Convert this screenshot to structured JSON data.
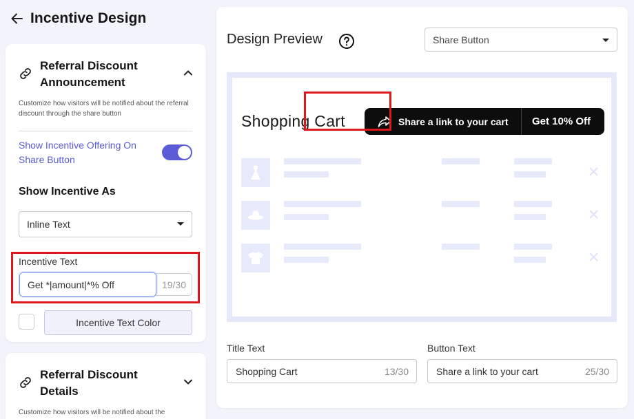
{
  "header": {
    "title": "Incentive Design"
  },
  "sections": [
    {
      "title": "Referral Discount Announcement",
      "description": "Customize how visitors will be notified about the referral discount through the share button",
      "toggle_label": "Show Incentive Offering On Share Button",
      "toggle_on": true,
      "show_as_label": "Show Incentive As",
      "show_as_value": "Inline Text",
      "incentive_text_label": "Incentive Text",
      "incentive_text_value": "Get *|amount|*% Off",
      "incentive_text_count": "19/30",
      "color_button_label": "Incentive Text Color"
    },
    {
      "title": "Referral Discount Details",
      "description": "Customize how visitors will be notified about the"
    }
  ],
  "preview": {
    "title": "Design Preview",
    "select_value": "Share Button",
    "cart_title": "Shopping Cart",
    "share_button_label": "Share a link to your cart",
    "incentive_badge": "Get 10% Off",
    "items": [
      {
        "icon": "dress-icon"
      },
      {
        "icon": "hat-icon"
      },
      {
        "icon": "tshirt-icon"
      }
    ]
  },
  "fields": {
    "title_label": "Title Text",
    "title_value": "Shopping Cart",
    "title_count": "13/30",
    "button_label": "Button Text",
    "button_value": "Share a link to your cart",
    "button_count": "25/30"
  },
  "colors": {
    "accent": "#5b5bd6",
    "highlight": "#e0161f",
    "preview_bg": "#e5e8fa",
    "share_button": "#0d0d0d"
  }
}
